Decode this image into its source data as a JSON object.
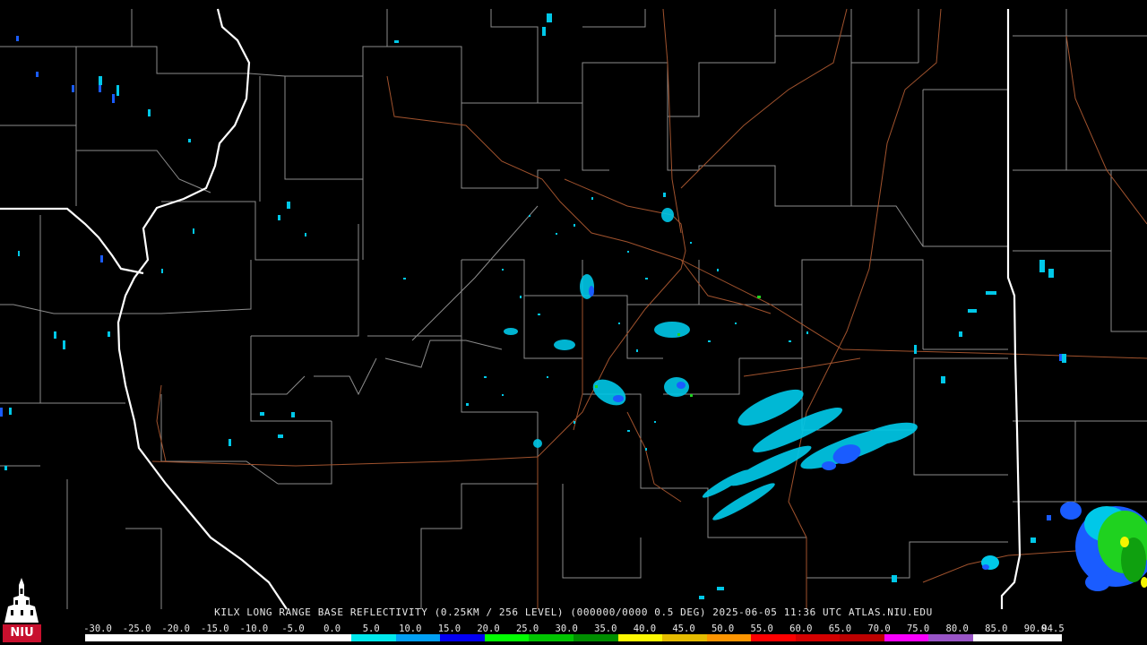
{
  "product": {
    "caption": "KILX LONG RANGE BASE REFLECTIVITY (0.25KM / 256 LEVEL) (000000/0000 0.5 DEG) 2025-06-05 11:36 UTC  ATLAS.NIU.EDU"
  },
  "logo": {
    "text": "NIU",
    "icon": "niu-tower-logo-icon"
  },
  "scale": {
    "labels": [
      "-30.0",
      "-25.0",
      "-20.0",
      "-15.0",
      "-10.0",
      "-5.0",
      "0.0",
      "5.0",
      "10.0",
      "15.0",
      "20.0",
      "25.0",
      "30.0",
      "35.0",
      "40.0",
      "45.0",
      "50.0",
      "55.0",
      "60.0",
      "65.0",
      "70.0",
      "75.0",
      "80.0",
      "85.0",
      "90.0",
      "94.5"
    ],
    "colors": [
      "#ffffff",
      "#ffffff",
      "#ffffff",
      "#ffffff",
      "#ffffff",
      "#ffffff",
      "#00e8ec",
      "#019ff4",
      "#0300f4",
      "#02fd02",
      "#01c501",
      "#008e00",
      "#fdf802",
      "#e5bc00",
      "#fd9500",
      "#fd0000",
      "#d40000",
      "#bc0000",
      "#f800fd",
      "#9854c6",
      "#fdfdfd",
      "#fdfdfd"
    ]
  },
  "colors": {
    "background": "#000000",
    "county_lines": "#8c8c8c",
    "state_lines": "#ffffff",
    "highways": "#a0522d",
    "echo_light": "#00c8e8",
    "echo_mid": "#1a5cff",
    "echo_green": "#1fd21f",
    "echo_yellow": "#f5f500"
  }
}
